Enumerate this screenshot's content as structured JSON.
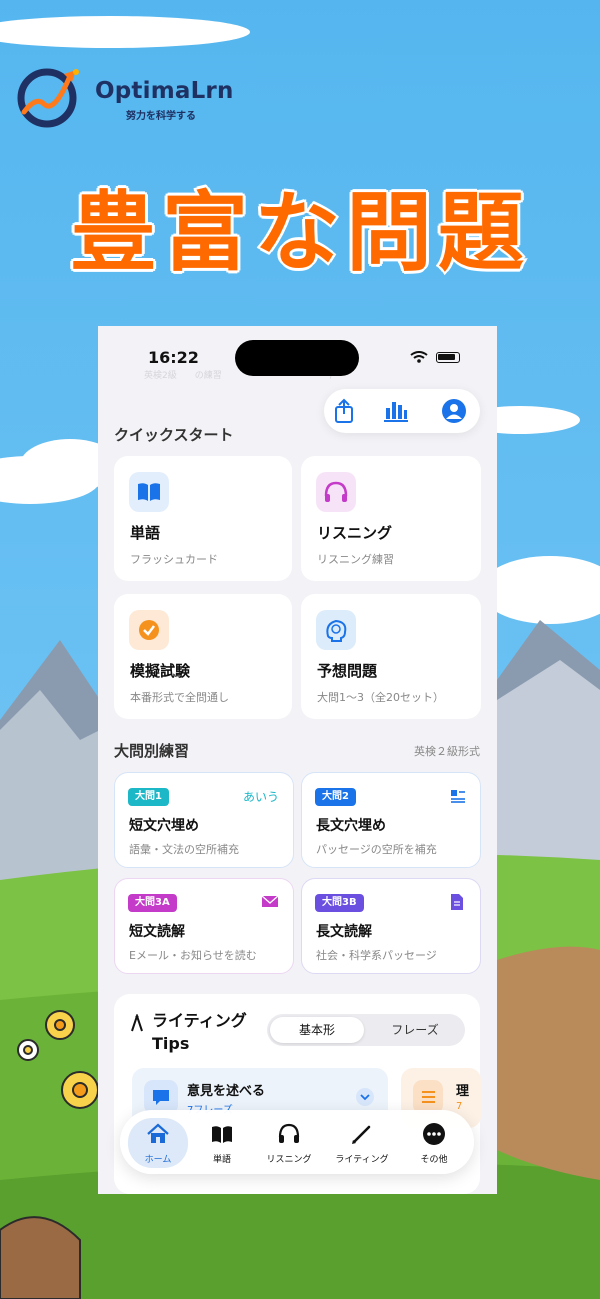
{
  "brand": {
    "name": "OptimaLrn",
    "tagline": "努力を科学する"
  },
  "headline": "豊富な問題",
  "status_bar": {
    "time": "16:22",
    "faded_text": "英検2級　　の練習　　　　　　　　　　　　/"
  },
  "quick_start": {
    "title": "クイックスタート",
    "cards": [
      {
        "title": "単語",
        "subtitle": "フラッシュカード",
        "icon": "book-icon"
      },
      {
        "title": "リスニング",
        "subtitle": "リスニング練習",
        "icon": "headphones-icon"
      },
      {
        "title": "模擬試験",
        "subtitle": "本番形式で全問通し",
        "icon": "checkmark-icon"
      },
      {
        "title": "予想問題",
        "subtitle": "大問1〜3（全20セット）",
        "icon": "brain-icon"
      }
    ]
  },
  "practice": {
    "title": "大問別練習",
    "note": "英検２級形式",
    "cards": [
      {
        "badge": "大問1",
        "hint": "あいう",
        "title": "短文穴埋め",
        "subtitle": "語彙・文法の空所補充",
        "icon": "text-hint"
      },
      {
        "badge": "大問2",
        "hint": "",
        "title": "長文穴埋め",
        "subtitle": "パッセージの空所を補充",
        "icon": "list-add-icon"
      },
      {
        "badge": "大問3A",
        "hint": "",
        "title": "短文読解",
        "subtitle": "Eメール・お知らせを読む",
        "icon": "envelope-icon"
      },
      {
        "badge": "大問3B",
        "hint": "",
        "title": "長文読解",
        "subtitle": "社会・科学系パッセージ",
        "icon": "document-icon"
      }
    ]
  },
  "writing_tips": {
    "title": "ライティング Tips",
    "segments": [
      "基本形",
      "フレーズ"
    ],
    "selected_segment": "基本形",
    "items": [
      {
        "title": "意見を述べる",
        "count": "7フレーズ",
        "icon": "speech-bubble-icon"
      },
      {
        "title": "理",
        "count": "7",
        "icon": "list-icon"
      }
    ]
  },
  "tabbar": {
    "tabs": [
      {
        "label": "ホーム",
        "icon": "house-icon",
        "active": true
      },
      {
        "label": "単語",
        "icon": "book-icon",
        "active": false
      },
      {
        "label": "リスニング",
        "icon": "headphones-icon",
        "active": false
      },
      {
        "label": "ライティング",
        "icon": "pencil-icon",
        "active": false
      },
      {
        "label": "その他",
        "icon": "more-icon",
        "active": false
      }
    ]
  },
  "colors": {
    "accent_blue": "#1a73e8",
    "headline_orange": "#ff6a00",
    "badge_teal": "#1cb8c8",
    "badge_blue": "#1a73e8",
    "badge_magenta": "#c43ac9",
    "badge_purple": "#6a4fe0"
  }
}
